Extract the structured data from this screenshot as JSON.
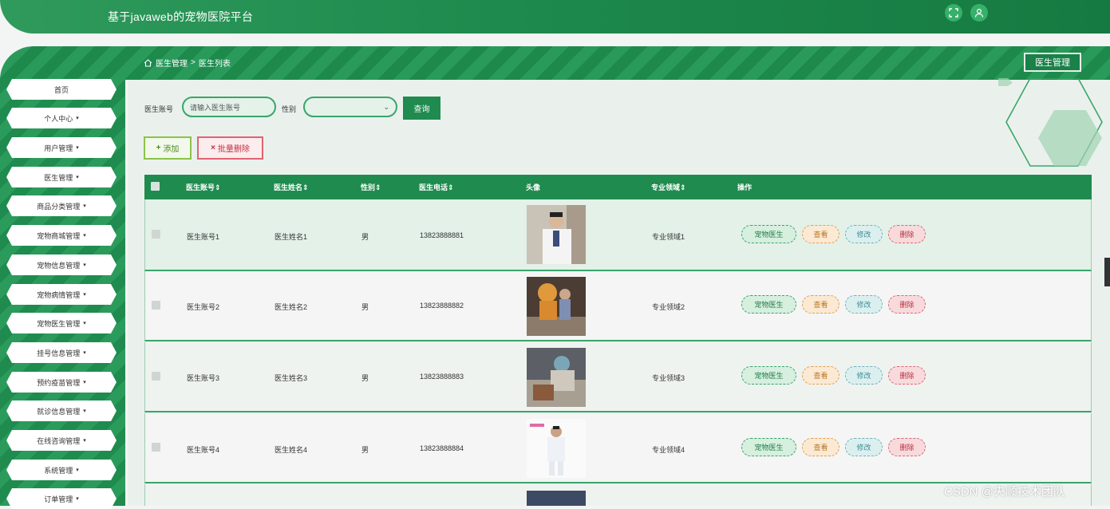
{
  "app": {
    "title": "基于javaweb的宠物医院平台"
  },
  "header_icons": [
    "fullscreen-icon",
    "user-icon"
  ],
  "breadcrumb": {
    "home_icon": "home-icon",
    "section": "医生管理",
    "separator": ">",
    "page": "医生列表"
  },
  "band_button": "医生管理",
  "sidebar": {
    "items": [
      {
        "label": "首页",
        "caret": ""
      },
      {
        "label": "个人中心",
        "caret": "▾"
      },
      {
        "label": "用户管理",
        "caret": "▾"
      },
      {
        "label": "医生管理",
        "caret": "▾"
      },
      {
        "label": "商品分类管理",
        "caret": "▾"
      },
      {
        "label": "宠物商城管理",
        "caret": "▾"
      },
      {
        "label": "宠物信息管理",
        "caret": "▾"
      },
      {
        "label": "宠物病情管理",
        "caret": "▾"
      },
      {
        "label": "宠物医生管理",
        "caret": "▾"
      },
      {
        "label": "挂号信息管理",
        "caret": "▾"
      },
      {
        "label": "预约疫苗管理",
        "caret": "▾"
      },
      {
        "label": "就诊信息管理",
        "caret": "▾"
      },
      {
        "label": "在线咨询管理",
        "caret": "▾"
      },
      {
        "label": "系统管理",
        "caret": "▾"
      },
      {
        "label": "订单管理",
        "caret": "▾"
      }
    ]
  },
  "search": {
    "account_label": "医生账号",
    "account_placeholder": "请输入医生账号",
    "gender_label": "性别",
    "gender_value": "",
    "search_button": "查询"
  },
  "actions": {
    "add": "添加",
    "add_icon": "+",
    "batch_delete": "批量删除",
    "batch_delete_icon": "×"
  },
  "table": {
    "columns": [
      "医生账号",
      "医生姓名",
      "性别",
      "医生电话",
      "头像",
      "专业领域",
      "操作"
    ],
    "sort_mark": "⇕",
    "rows": [
      {
        "account": "医生账号1",
        "name": "医生姓名1",
        "gender": "男",
        "phone": "13823888881",
        "field": "专业领域1"
      },
      {
        "account": "医生账号2",
        "name": "医生姓名2",
        "gender": "男",
        "phone": "13823888882",
        "field": "专业领域2"
      },
      {
        "account": "医生账号3",
        "name": "医生姓名3",
        "gender": "男",
        "phone": "13823888883",
        "field": "专业领域3"
      },
      {
        "account": "医生账号4",
        "name": "医生姓名4",
        "gender": "男",
        "phone": "13823888884",
        "field": "专业领域4"
      }
    ],
    "row_actions": [
      "宠物医生",
      "查看",
      "修改",
      "删除"
    ]
  },
  "watermark": "CSDN @央顺技术团队",
  "colors": {
    "primary": "#1f8b4e",
    "accent_light": "#3aa56a",
    "danger": "#c6303f",
    "add": "#8bc34a"
  }
}
